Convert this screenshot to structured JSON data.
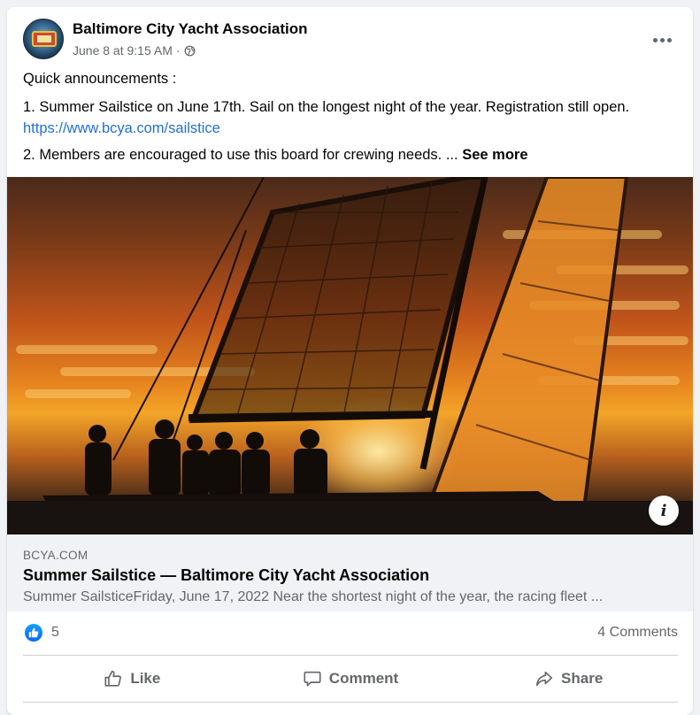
{
  "post": {
    "page_name": "Baltimore City Yacht Association",
    "timestamp": "June 8 at 9:15 AM",
    "separator": "·",
    "privacy_icon": "globe-icon",
    "more_icon": "more-options-icon",
    "text": {
      "line1": "Quick announcements :",
      "line2": "1. Summer Sailstice on June 17th. Sail on the longest night of the year. Registration still open.",
      "link": "https://www.bcya.com/sailstice",
      "line3": "2. Members are encouraged to use this board for crewing needs. ...",
      "see_more": "See more"
    },
    "image_icon": "info-icon"
  },
  "link_preview": {
    "domain": "BCYA.COM",
    "title": "Summer Sailstice — Baltimore City Yacht Association",
    "description": "Summer SailsticeFriday, June 17, 2022 Near the shortest night of the year, the racing fleet ..."
  },
  "stats": {
    "reaction_icon": "like-reaction-icon",
    "reaction_count": "5",
    "comments": "4 Comments"
  },
  "actions": {
    "like": "Like",
    "comment": "Comment",
    "share": "Share"
  },
  "colors": {
    "link": "#216fdb",
    "secondary_text": "#65676b",
    "like_blue": "#0866ff",
    "preview_bg": "#f0f2f5"
  }
}
